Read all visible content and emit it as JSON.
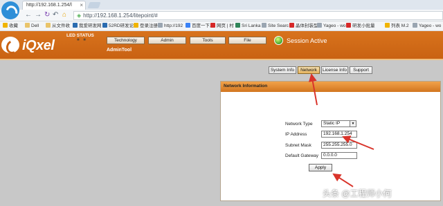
{
  "browser": {
    "tab_title": "http://192.168.1.254/l",
    "tab_close": "×",
    "url": "http://192.168.1.254/litepoint/#",
    "nav": {
      "back": "←",
      "forward": "→",
      "reload": "↻",
      "undo": "↶",
      "home": "⌂"
    }
  },
  "bookmarks": [
    {
      "label": "收藏",
      "color": "#f0b400"
    },
    {
      "label": "Dell",
      "color": "#e9c46a"
    },
    {
      "label": "从文件收",
      "color": "#e9c46a"
    },
    {
      "label": "我爱研发网",
      "color": "#2b6cb0"
    },
    {
      "label": "52RD研发论",
      "color": "#2b6cb0"
    },
    {
      "label": "登录注册",
      "color": "#f0b400"
    },
    {
      "label": "http://192",
      "color": "#9aa5b1"
    },
    {
      "label": "百度一下,",
      "color": "#3b82f6"
    },
    {
      "label": "网页 | 村",
      "color": "#d62828"
    },
    {
      "label": "Sri Lanka",
      "color": "#2f855a"
    },
    {
      "label": "Site Searc",
      "color": "#9aa5b1"
    },
    {
      "label": "晶体封装型",
      "color": "#d62828"
    },
    {
      "label": "Yageo - wo",
      "color": "#9aa5b1"
    },
    {
      "label": "研发小批量",
      "color": "#d62828"
    },
    {
      "label": "列表 M.2",
      "color": "#f0b400"
    },
    {
      "label": "Yageo - wo",
      "color": "#9aa5b1"
    }
  ],
  "app": {
    "logo": "iQxel",
    "led_status_label": "LED STATUS",
    "led_dots": "■ ■",
    "nav": [
      "Technology",
      "Admin",
      "Tools",
      "File"
    ],
    "admin_tool_label": "AdminTool",
    "session_status": "Session Active",
    "session_color": "#3fa22a",
    "accent_color": "#d2761f"
  },
  "subtabs": [
    "System Info",
    "Network",
    "License Info",
    "Support"
  ],
  "active_subtab": "Network",
  "panel": {
    "title": "Network Information",
    "fields": {
      "network_type": {
        "label": "Network Type",
        "value": "Static IP",
        "arrow": "▼"
      },
      "ip_address": {
        "label": "IP Address",
        "value": "192.168.1.254"
      },
      "subnet_mask": {
        "label": "Subnet Mask",
        "value": "255.255.255.0"
      },
      "default_gateway": {
        "label": "Default Gateway",
        "value": "0.0.0.0"
      }
    },
    "apply_label": "Apply"
  },
  "watermark": "头条 @工程师小何",
  "annotation_color": "#d9342b"
}
